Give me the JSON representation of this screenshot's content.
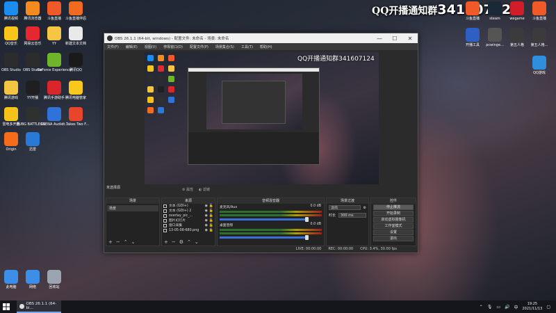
{
  "watermark": {
    "prefix": "QQ开播通知群",
    "number": "341607124"
  },
  "desktop_left": [
    {
      "label": "腾讯视频",
      "icon": "video-icon",
      "color": "#1b8cf0"
    },
    {
      "label": "腾讯浏览器",
      "icon": "browser-icon",
      "color": "#f58a1f"
    },
    {
      "label": "斗鱼直播",
      "icon": "douyu-icon",
      "color": "#f05a28"
    },
    {
      "label": "斗鱼直播伴侣",
      "icon": "douyu-companion-icon",
      "color": "#f06a20"
    },
    {
      "label": "QQ音乐",
      "icon": "qqmusic-icon",
      "color": "#f7c51c"
    },
    {
      "label": "网易云音乐",
      "icon": "netease-music-icon",
      "color": "#e3282f"
    },
    {
      "label": "YY",
      "icon": "yy-icon",
      "color": "#f6c543"
    },
    {
      "label": "新建文本文档",
      "icon": "text-file-icon",
      "color": "#e9e9e9"
    },
    {
      "label": "OBS Studio",
      "icon": "obs-icon",
      "color": "#2c2c2c"
    },
    {
      "label": "OBS Studio",
      "icon": "obs-icon",
      "color": "#2c2c2c"
    },
    {
      "label": "GeForce Experience",
      "icon": "nvidia-icon",
      "color": "#6fb52c"
    },
    {
      "label": "腾讯QQ",
      "icon": "qq-icon",
      "color": "#1a1a1a"
    },
    {
      "label": "腾讯游戏",
      "icon": "folder-icon",
      "color": "#f4c542"
    },
    {
      "label": "YY开播",
      "icon": "yy-live-icon",
      "color": "#1f1f1f"
    },
    {
      "label": "腾讯手游助手",
      "icon": "game-assist-icon",
      "color": "#d9262b"
    },
    {
      "label": "腾讯电脑管家",
      "icon": "pc-manager-icon",
      "color": "#f8c81c"
    },
    {
      "label": "雷电多开器",
      "icon": "ldplayer-icon",
      "color": "#f4c21a"
    },
    {
      "label": "PUBG BATTLEGR...",
      "icon": "pubg-icon",
      "color": "#303030"
    },
    {
      "label": "XSENA Audio ...",
      "icon": "audio-icon",
      "color": "#2f73d8"
    },
    {
      "label": "It Takes Two F...",
      "icon": "game-icon",
      "color": "#e8452b"
    },
    {
      "label": "Origin",
      "icon": "origin-icon",
      "color": "#f56c1d"
    },
    {
      "label": "迅雷",
      "icon": "thunder-icon",
      "color": "#2979d9"
    }
  ],
  "desktop_bottom": [
    {
      "label": "此电脑",
      "icon": "computer-icon",
      "color": "#3c8ee8"
    },
    {
      "label": "网络",
      "icon": "network-icon",
      "color": "#3c8ee8"
    },
    {
      "label": "回收站",
      "icon": "recycle-bin-icon",
      "color": "#9aa5b1"
    }
  ],
  "desktop_right": [
    {
      "label": "斗鱼直播",
      "icon": "douyu-icon",
      "color": "#f05a28"
    },
    {
      "label": "steam",
      "icon": "steam-icon",
      "color": "#1b2838"
    },
    {
      "label": "wegame",
      "icon": "wegame-icon",
      "color": "#d11d27"
    },
    {
      "label": "斗鱼直播",
      "icon": "douyu-icon",
      "color": "#f05a28"
    },
    {
      "label": "开播工具",
      "icon": "tool-icon",
      "color": "#2e5fc4"
    },
    {
      "label": "pcwinge...",
      "icon": "app-icon",
      "color": "#555555"
    },
    {
      "label": "第五人格",
      "icon": "identity-icon",
      "color": "#3b3b3b"
    },
    {
      "label": "第五人格...",
      "icon": "identity-icon",
      "color": "#3b3b3b"
    },
    {
      "label": "QQ游戏",
      "icon": "qqgame-icon",
      "color": "#2f8ee0"
    }
  ],
  "obs": {
    "title": "OBS 26.1.1 (64-bit, windows) - 配置文件: 未命名 - 场景: 未命名",
    "menu": [
      "文件(F)",
      "编辑(E)",
      "视图(V)",
      "停靠窗口(D)",
      "配置文件(P)",
      "场景集合(S)",
      "工具(T)",
      "帮助(H)"
    ],
    "preview_status": "未选择源",
    "scene_toolbar": [
      "属性",
      "滤镜"
    ],
    "docks": {
      "scenes": {
        "title": "场景",
        "items": [
          "场景"
        ]
      },
      "sources": {
        "title": "来源",
        "items": [
          "文本 (GDI+)",
          "文本 (GDI+) 2",
          "overlay_pic_...",
          "图片幻灯片",
          "窗口采集",
          "13-05-08-680.png"
        ]
      },
      "mixer": {
        "title": "音频混音器",
        "channels": [
          {
            "name": "麦克风/Aux",
            "db": "0.0 dB"
          },
          {
            "name": "桌面音频",
            "db": "0.0 dB"
          }
        ]
      },
      "transitions": {
        "title": "场景过渡",
        "type": "淡出",
        "duration_label": "时长",
        "duration": "300 ms"
      },
      "controls": {
        "title": "控件",
        "buttons": [
          "停止推流",
          "开始录制",
          "启动虚拟摄像机",
          "工作室模式",
          "设置",
          "退出"
        ]
      }
    },
    "status": {
      "live": "LIVE: 00:00:00",
      "rec": "REC: 00:00:00",
      "cpu": "CPU: 3.4%, 30.00 fps"
    }
  },
  "taskbar": {
    "app_label": "OBS 26.1.1 (64-bi...",
    "time": "19:25",
    "date": "2021/11/13"
  }
}
